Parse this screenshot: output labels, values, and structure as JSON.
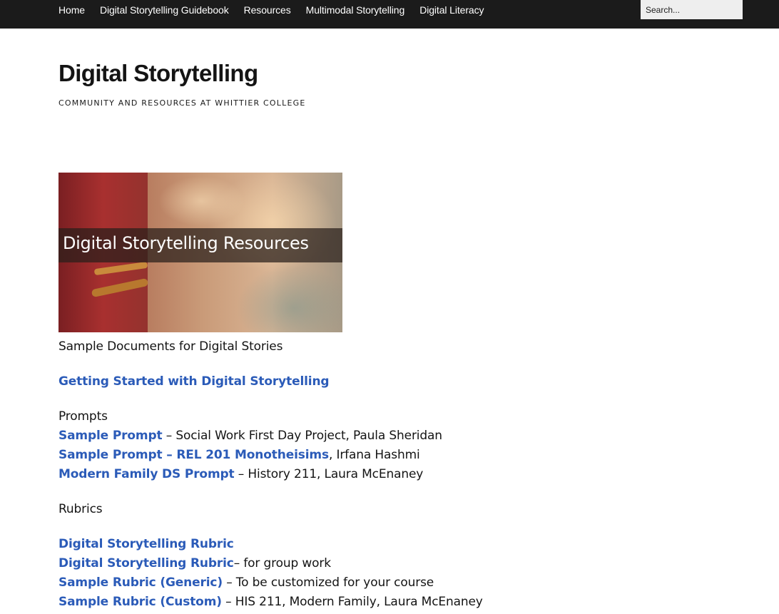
{
  "nav": {
    "items": [
      {
        "label": "Home"
      },
      {
        "label": "Digital Storytelling Guidebook"
      },
      {
        "label": "Resources"
      },
      {
        "label": "Multimodal Storytelling"
      },
      {
        "label": "Digital Literacy"
      }
    ],
    "search_placeholder": "Search..."
  },
  "header": {
    "title": "Digital Storytelling",
    "tagline": "COMMUNITY AND RESOURCES AT WHITTIER COLLEGE"
  },
  "hero": {
    "caption": "Digital Storytelling Resources"
  },
  "content": {
    "intro": "Sample Documents for Digital Stories",
    "getting_started_link": "Getting Started with Digital Storytelling",
    "prompts_heading": "Prompts",
    "prompts": [
      {
        "link": "Sample Prompt",
        "desc": " – Social Work First Day Project, Paula Sheridan"
      },
      {
        "link": "Sample Prompt – REL 201 Monotheisims",
        "desc": ", Irfana Hashmi"
      },
      {
        "link": "Modern Family DS Prompt",
        "desc": " – History 211, Laura McEnaney"
      }
    ],
    "rubrics_heading": "Rubrics",
    "rubrics": [
      {
        "link": "Digital Storytelling Rubric",
        "desc": ""
      },
      {
        "link": "Digital Storytelling Rubric",
        "desc": "– for group work"
      },
      {
        "link": "Sample Rubric (Generic)",
        "desc": " – To be customized for your course"
      },
      {
        "link": "Sample Rubric (Custom)",
        "desc": " – HIS 211, Modern Family, Laura McEnaney"
      }
    ]
  },
  "colors": {
    "topbar": "#1b1b1b",
    "link": "#2b5bb8",
    "text": "#141414"
  }
}
